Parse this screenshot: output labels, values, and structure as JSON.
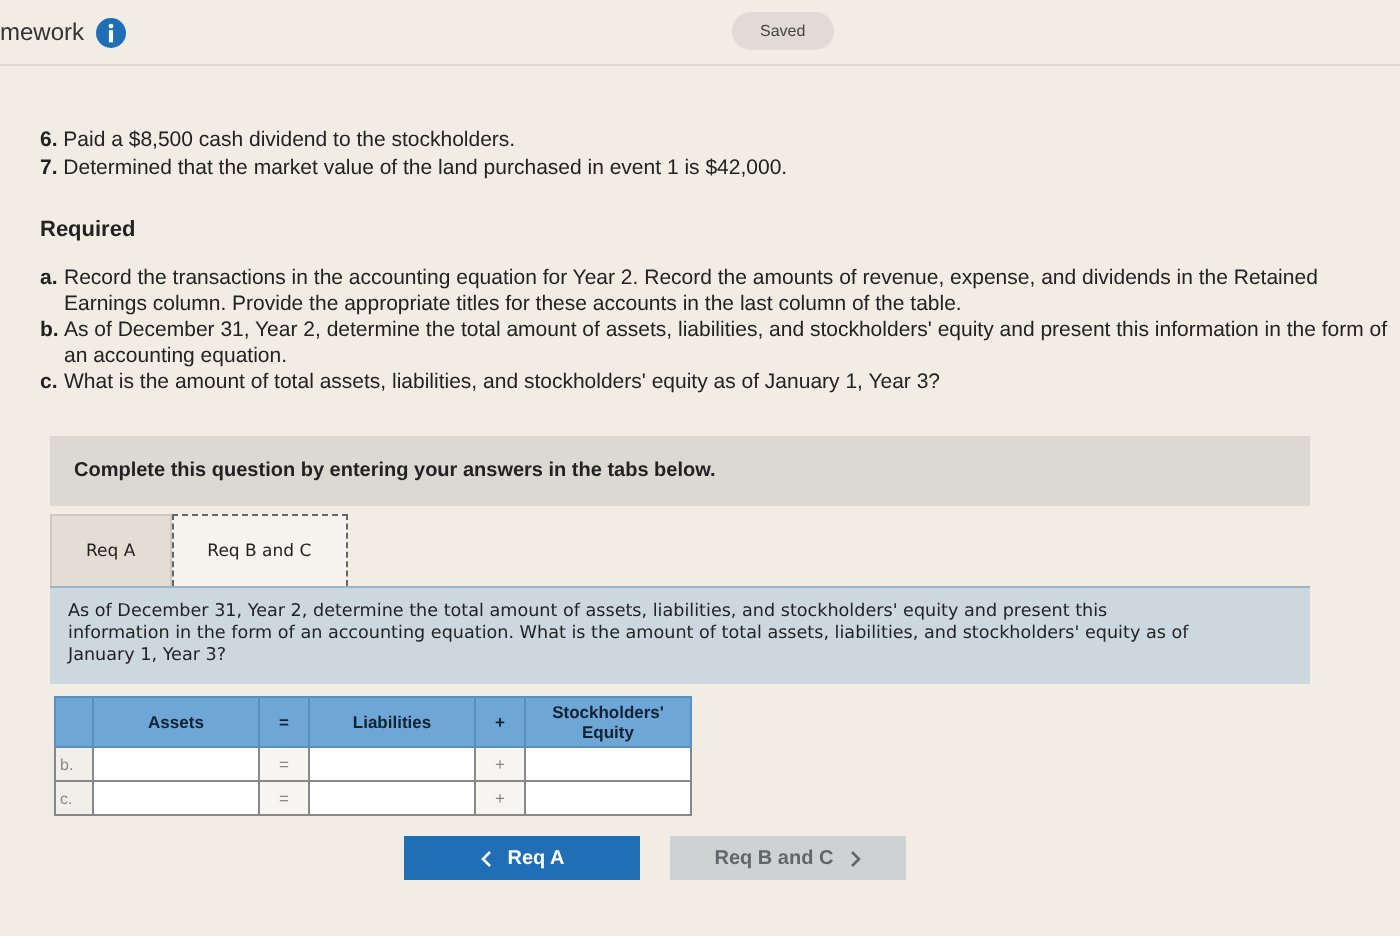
{
  "header": {
    "title": "mework",
    "status": "Saved"
  },
  "events": [
    "**6.** Paid a $8,500 cash dividend to the stockholders.",
    "**7.** Determined that the market value of the land purchased in event 1 is $42,000."
  ],
  "required": {
    "heading": "Required",
    "items": [
      {
        "marker": "a.",
        "text": "Record the transactions in the accounting equation for Year 2. Record the amounts of revenue, expense, and dividends in the Retained Earnings column. Provide the appropriate titles for these accounts in the last column of the table."
      },
      {
        "marker": "b.",
        "text": "As of December 31, Year 2, determine the total amount of assets, liabilities, and stockholders' equity and present this information in the form of an accounting equation."
      },
      {
        "marker": "c.",
        "text": "What is the amount of total assets, liabilities, and stockholders' equity as of January 1, Year 3?"
      }
    ]
  },
  "banner": "Complete this question by entering your answers in the tabs below.",
  "tabs": [
    {
      "label": "Req A",
      "selected": false
    },
    {
      "label": "Req B and C",
      "selected": true
    }
  ],
  "instruction": "As of December 31, Year 2, determine the total amount of assets, liabilities, and stockholders' equity and present this information in the form of an accounting equation. What is the amount of total assets, liabilities, and stockholders' equity as of January 1, Year 3?",
  "table": {
    "columns": [
      "Assets",
      "=",
      "Liabilities",
      "+",
      "Stockholders' Equity"
    ],
    "rows": [
      {
        "label": "b.",
        "ops": [
          "=",
          "+"
        ]
      },
      {
        "label": "c.",
        "ops": [
          "=",
          "+"
        ]
      }
    ]
  },
  "nav": [
    {
      "label": "Req A",
      "kind": "prev",
      "disabled": false
    },
    {
      "label": "Req B and C",
      "kind": "next",
      "disabled": true
    }
  ]
}
